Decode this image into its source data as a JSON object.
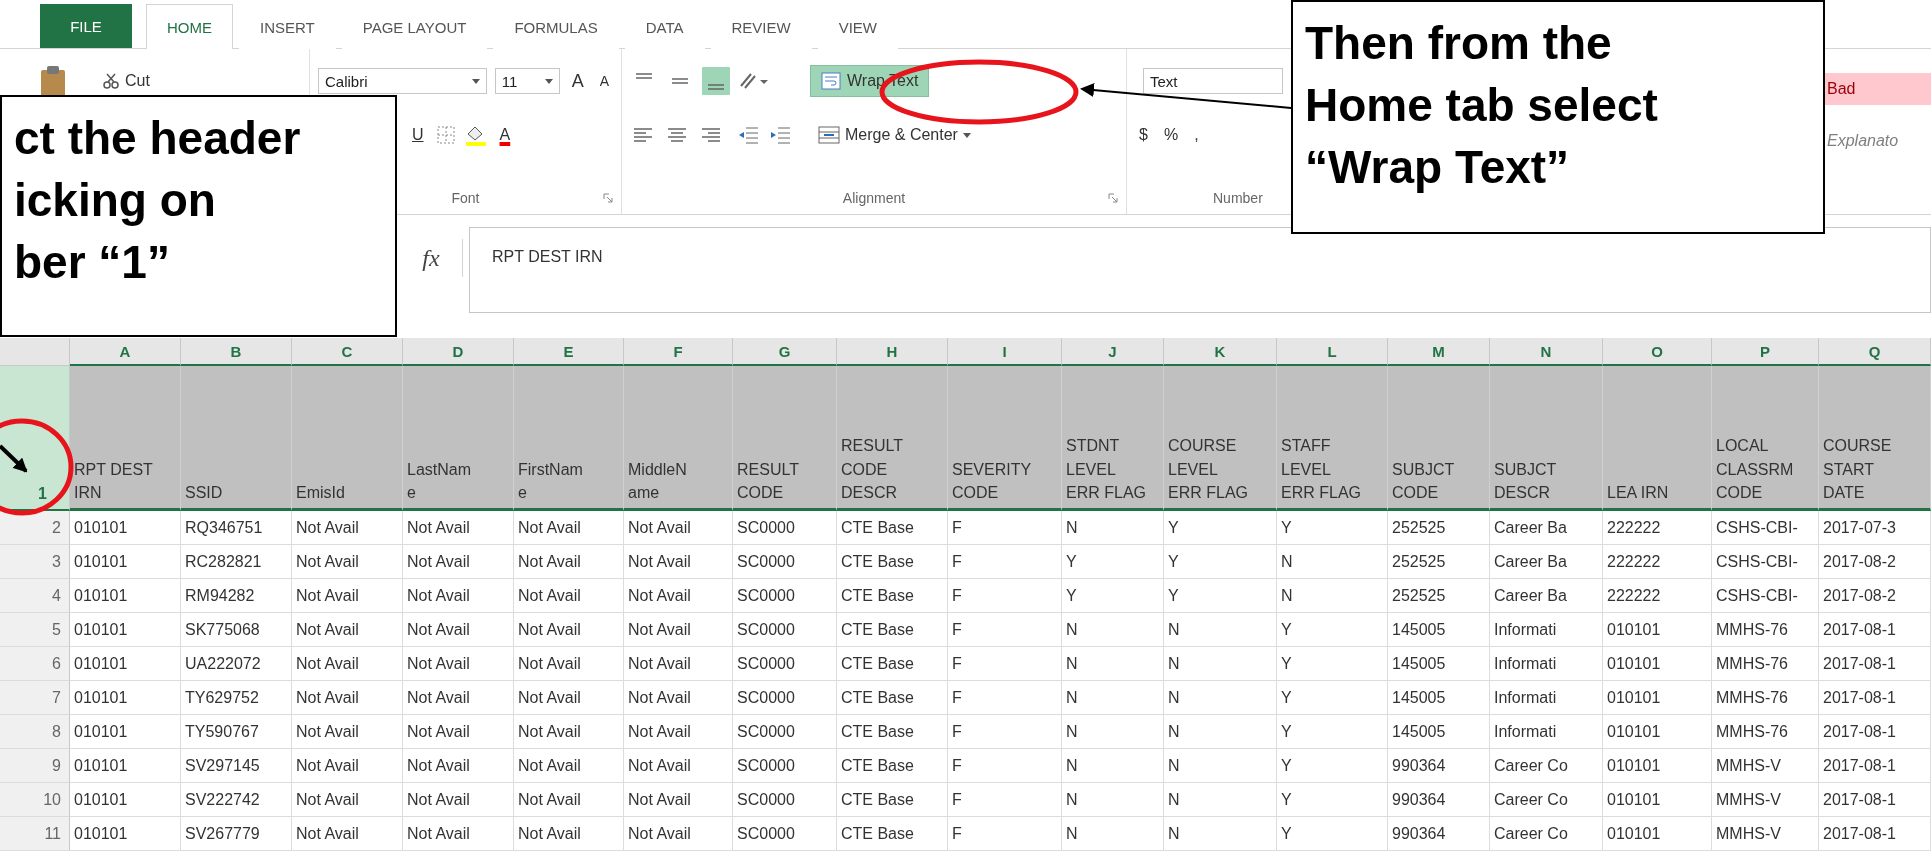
{
  "ribbon": {
    "tabs": [
      {
        "label": "FILE",
        "kind": "file",
        "selected": false
      },
      {
        "label": "HOME",
        "kind": "tab",
        "selected": true
      },
      {
        "label": "INSERT",
        "kind": "tab",
        "selected": false
      },
      {
        "label": "PAGE LAYOUT",
        "kind": "tab",
        "selected": false
      },
      {
        "label": "FORMULAS",
        "kind": "tab",
        "selected": false
      },
      {
        "label": "DATA",
        "kind": "tab",
        "selected": false
      },
      {
        "label": "REVIEW",
        "kind": "tab",
        "selected": false
      },
      {
        "label": "VIEW",
        "kind": "tab",
        "selected": false
      }
    ],
    "clipboard": {
      "cut": "Cut"
    },
    "font": {
      "name": "Calibri",
      "size": "11",
      "grow": "A",
      "shrink": "A",
      "underline": "U",
      "font_color": "A",
      "label": "Font"
    },
    "alignment": {
      "vertical": [
        {
          "kind": "top",
          "selected": false
        },
        {
          "kind": "middle",
          "selected": false
        },
        {
          "kind": "bottom",
          "selected": true
        }
      ],
      "horizontal": [
        {
          "kind": "left",
          "selected": false
        },
        {
          "kind": "center",
          "selected": false
        },
        {
          "kind": "right",
          "selected": false
        }
      ],
      "wrap_text": {
        "label": "Wrap Text",
        "selected": true
      },
      "merge": "Merge & Center",
      "label": "Alignment"
    },
    "number": {
      "format": "Text",
      "currency": "$",
      "percent": "%",
      "comma": ",",
      "label": "Number"
    },
    "styles": [
      {
        "label": "Bad",
        "kind": "bad"
      },
      {
        "label": "Explanato",
        "kind": "explanatory"
      }
    ]
  },
  "formula_bar": {
    "fx": "fx",
    "value": "RPT DEST IRN"
  },
  "sheet": {
    "columns": [
      "A",
      "B",
      "C",
      "D",
      "E",
      "F",
      "G",
      "H",
      "I",
      "J",
      "K",
      "L",
      "M",
      "N",
      "O",
      "P",
      "Q"
    ],
    "header_row": {
      "number": "1",
      "selected": true,
      "cells": [
        [
          "RPT DEST",
          "IRN"
        ],
        [
          "SSID"
        ],
        [
          "EmisId"
        ],
        [
          "LastNam",
          "e"
        ],
        [
          "FirstNam",
          "e"
        ],
        [
          "MiddleN",
          "ame"
        ],
        [
          "RESULT",
          "CODE"
        ],
        [
          "RESULT",
          "CODE",
          "DESCR"
        ],
        [
          "SEVERITY",
          "CODE"
        ],
        [
          "STDNT",
          "LEVEL",
          "ERR FLAG"
        ],
        [
          "COURSE",
          "LEVEL",
          "ERR FLAG"
        ],
        [
          "STAFF",
          "LEVEL",
          "ERR FLAG"
        ],
        [
          "SUBJCT",
          "CODE"
        ],
        [
          "SUBJCT",
          "DESCR"
        ],
        [
          "LEA IRN"
        ],
        [
          "LOCAL",
          "CLASSRM",
          "CODE"
        ],
        [
          "COURSE",
          "START",
          "DATE"
        ]
      ]
    },
    "rows": [
      {
        "number": "2",
        "cells": [
          "010101",
          "RQ346751",
          "Not Avail",
          "Not Avail",
          "Not Avail",
          "Not Avail",
          "SC0000",
          "CTE Base",
          "F",
          "N",
          "Y",
          "Y",
          "252525",
          "Career Ba",
          "222222",
          "CSHS-CBI-",
          "2017-07-3"
        ]
      },
      {
        "number": "3",
        "cells": [
          "010101",
          "RC282821",
          "Not Avail",
          "Not Avail",
          "Not Avail",
          "Not Avail",
          "SC0000",
          "CTE Base",
          "F",
          "Y",
          "Y",
          "N",
          "252525",
          "Career Ba",
          "222222",
          "CSHS-CBI-",
          "2017-08-2"
        ]
      },
      {
        "number": "4",
        "cells": [
          "010101",
          "RM94282",
          "Not Avail",
          "Not Avail",
          "Not Avail",
          "Not Avail",
          "SC0000",
          "CTE Base",
          "F",
          "Y",
          "Y",
          "N",
          "252525",
          "Career Ba",
          "222222",
          "CSHS-CBI-",
          "2017-08-2"
        ]
      },
      {
        "number": "5",
        "cells": [
          "010101",
          "SK775068",
          "Not Avail",
          "Not Avail",
          "Not Avail",
          "Not Avail",
          "SC0000",
          "CTE Base",
          "F",
          "N",
          "N",
          "Y",
          "145005",
          "Informati",
          "010101",
          "MMHS-76",
          "2017-08-1"
        ]
      },
      {
        "number": "6",
        "cells": [
          "010101",
          "UA222072",
          "Not Avail",
          "Not Avail",
          "Not Avail",
          "Not Avail",
          "SC0000",
          "CTE Base",
          "F",
          "N",
          "N",
          "Y",
          "145005",
          "Informati",
          "010101",
          "MMHS-76",
          "2017-08-1"
        ]
      },
      {
        "number": "7",
        "cells": [
          "010101",
          "TY629752",
          "Not Avail",
          "Not Avail",
          "Not Avail",
          "Not Avail",
          "SC0000",
          "CTE Base",
          "F",
          "N",
          "N",
          "Y",
          "145005",
          "Informati",
          "010101",
          "MMHS-76",
          "2017-08-1"
        ]
      },
      {
        "number": "8",
        "cells": [
          "010101",
          "TY590767",
          "Not Avail",
          "Not Avail",
          "Not Avail",
          "Not Avail",
          "SC0000",
          "CTE Base",
          "F",
          "N",
          "N",
          "Y",
          "145005",
          "Informati",
          "010101",
          "MMHS-76",
          "2017-08-1"
        ]
      },
      {
        "number": "9",
        "cells": [
          "010101",
          "SV297145",
          "Not Avail",
          "Not Avail",
          "Not Avail",
          "Not Avail",
          "SC0000",
          "CTE Base",
          "F",
          "N",
          "N",
          "Y",
          "990364",
          "Career Co",
          "010101",
          "MMHS-V",
          "2017-08-1"
        ]
      },
      {
        "number": "10",
        "cells": [
          "010101",
          "SV222742",
          "Not Avail",
          "Not Avail",
          "Not Avail",
          "Not Avail",
          "SC0000",
          "CTE Base",
          "F",
          "N",
          "N",
          "Y",
          "990364",
          "Career Co",
          "010101",
          "MMHS-V",
          "2017-08-1"
        ]
      },
      {
        "number": "11",
        "cells": [
          "010101",
          "SV267779",
          "Not Avail",
          "Not Avail",
          "Not Avail",
          "Not Avail",
          "SC0000",
          "CTE Base",
          "F",
          "N",
          "N",
          "Y",
          "990364",
          "Career Co",
          "010101",
          "MMHS-V",
          "2017-08-1"
        ]
      }
    ]
  },
  "callouts": [
    {
      "kind": "left",
      "text": "ct the header\nicking on\nber “1”"
    },
    {
      "kind": "right",
      "text": "Then from the\nHome tab select\n“Wrap Text”"
    }
  ]
}
